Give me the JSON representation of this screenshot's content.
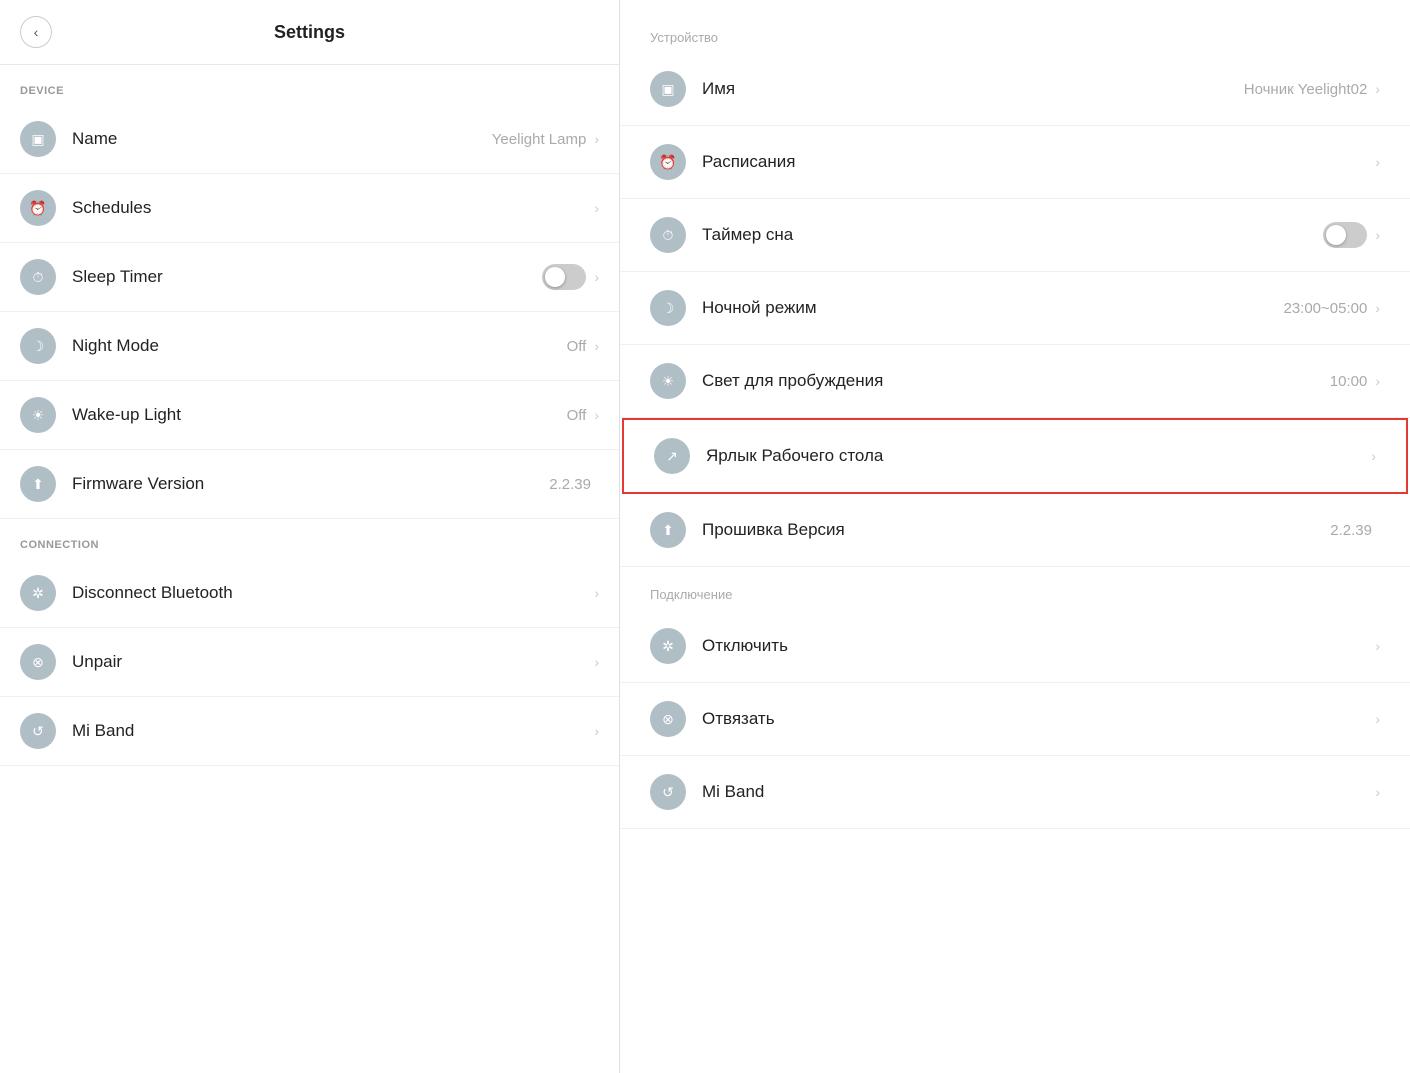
{
  "left": {
    "header": {
      "back_label": "‹",
      "title": "Settings"
    },
    "device_section_label": "DEVICE",
    "device_items": [
      {
        "id": "name",
        "icon": "▣",
        "label": "Name",
        "value": "Yeelight Lamp",
        "has_chevron": true,
        "has_toggle": false
      },
      {
        "id": "schedules",
        "icon": "⏰",
        "label": "Schedules",
        "value": "",
        "has_chevron": true,
        "has_toggle": false
      },
      {
        "id": "sleep-timer",
        "icon": "⏱",
        "label": "Sleep Timer",
        "value": "",
        "has_chevron": true,
        "has_toggle": true,
        "toggle_on": false
      },
      {
        "id": "night-mode",
        "icon": "☽",
        "label": "Night Mode",
        "value": "Off",
        "has_chevron": true,
        "has_toggle": false
      },
      {
        "id": "wake-up-light",
        "icon": "☀",
        "label": "Wake-up Light",
        "value": "Off",
        "has_chevron": true,
        "has_toggle": false
      },
      {
        "id": "firmware-version",
        "icon": "⬆",
        "label": "Firmware Version",
        "value": "2.2.39",
        "has_chevron": false,
        "has_toggle": false
      }
    ],
    "connection_section_label": "CONNECTION",
    "connection_items": [
      {
        "id": "disconnect-bluetooth",
        "icon": "✲",
        "label": "Disconnect Bluetooth",
        "value": "",
        "has_chevron": true
      },
      {
        "id": "unpair",
        "icon": "⊗",
        "label": "Unpair",
        "value": "",
        "has_chevron": true
      },
      {
        "id": "mi-band",
        "icon": "↺",
        "label": "Mi Band",
        "value": "",
        "has_chevron": true
      }
    ]
  },
  "right": {
    "device_section_label": "Устройство",
    "device_items": [
      {
        "id": "name-ru",
        "icon": "▣",
        "label": "Имя",
        "value": "Ночник Yeelight02",
        "has_chevron": true,
        "has_toggle": false,
        "highlighted": false
      },
      {
        "id": "schedules-ru",
        "icon": "⏰",
        "label": "Расписания",
        "value": "",
        "has_chevron": true,
        "has_toggle": false,
        "highlighted": false
      },
      {
        "id": "sleep-timer-ru",
        "icon": "⏱",
        "label": "Таймер сна",
        "value": "",
        "has_chevron": true,
        "has_toggle": true,
        "toggle_on": false,
        "highlighted": false
      },
      {
        "id": "night-mode-ru",
        "icon": "☽",
        "label": "Ночной режим",
        "value": "23:00~05:00",
        "has_chevron": true,
        "has_toggle": false,
        "highlighted": false
      },
      {
        "id": "wake-up-light-ru",
        "icon": "☀",
        "label": "Свет для пробуждения",
        "value": "10:00",
        "has_chevron": true,
        "has_toggle": false,
        "highlighted": false
      },
      {
        "id": "shortcut-ru",
        "icon": "↗",
        "label": "Ярлык Рабочего стола",
        "value": "",
        "has_chevron": true,
        "has_toggle": false,
        "highlighted": true
      },
      {
        "id": "firmware-ru",
        "icon": "⬆",
        "label": "Прошивка Версия",
        "value": "2.2.39",
        "has_chevron": false,
        "has_toggle": false,
        "highlighted": false
      }
    ],
    "connection_section_label": "Подключение",
    "connection_items": [
      {
        "id": "disconnect-ru",
        "icon": "✲",
        "label": "Отключить",
        "value": "",
        "has_chevron": true
      },
      {
        "id": "unpair-ru",
        "icon": "⊗",
        "label": "Отвязать",
        "value": "",
        "has_chevron": true
      },
      {
        "id": "mi-band-ru",
        "icon": "↺",
        "label": "Mi Band",
        "value": "",
        "has_chevron": true
      }
    ]
  }
}
